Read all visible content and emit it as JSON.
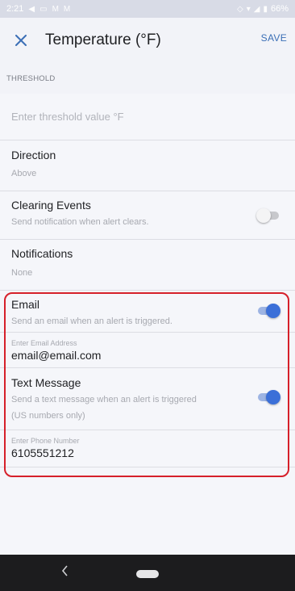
{
  "status_bar": {
    "time": "2:21",
    "battery": "66%"
  },
  "app_bar": {
    "title": "Temperature (°F)",
    "save_label": "SAVE"
  },
  "threshold": {
    "section_label": "THRESHOLD",
    "placeholder": "Enter threshold value °F"
  },
  "direction": {
    "label": "Direction",
    "value": "Above"
  },
  "clearing_events": {
    "label": "Clearing Events",
    "description": "Send notification when alert clears.",
    "enabled": false
  },
  "notifications": {
    "label": "Notifications",
    "value": "None"
  },
  "email": {
    "label": "Email",
    "description": "Send an email when an alert is triggered.",
    "enabled": true,
    "address_label": "Enter Email Address",
    "address_value": "email@email.com"
  },
  "text_message": {
    "label": "Text Message",
    "description": "Send a text message when an alert is triggered",
    "description_note": "(US numbers only)",
    "enabled": true,
    "phone_label": "Enter Phone Number",
    "phone_value": "6105551212"
  },
  "colors": {
    "accent": "#3b6fd8",
    "highlight": "#d6202a"
  },
  "icons": {
    "close": "close-icon",
    "back": "back-icon",
    "home": "home-pill-icon"
  }
}
